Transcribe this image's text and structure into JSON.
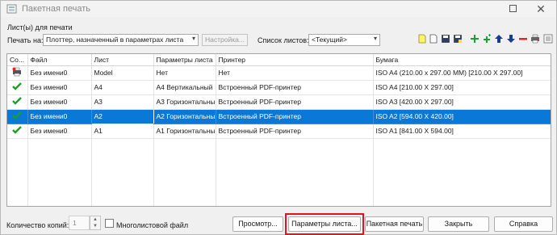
{
  "window": {
    "title": "Пакетная печать"
  },
  "section_label": "Лист(ы) для печати",
  "print_to": {
    "label": "Печать на:",
    "value": "Плоттер, назначенный в параметрах листа",
    "setup_label": "Настройка..."
  },
  "sheet_list": {
    "label": "Список листов:",
    "value": "<Текущий>"
  },
  "toolbar": {
    "icons": [
      "new-sheet-list-icon",
      "load-sheet-list-icon",
      "save-sheet-list-icon",
      "save-as-sheet-list-icon",
      "add-sheets-icon",
      "add-layouts-icon",
      "move-up-icon",
      "move-down-icon",
      "remove-sheets-icon",
      "plotter-manager-icon",
      "more-options-icon"
    ]
  },
  "table": {
    "headers": [
      "Со...",
      "Файл",
      "Лист",
      "Параметры листа",
      "Принтер",
      "Бумага"
    ],
    "rows": [
      {
        "status": "plot-icon",
        "file": "Без имени0",
        "sheet": "Model",
        "params": "Нет",
        "printer": "Нет",
        "paper": "ISO A4 (210.00 x 297.00 MM) [210.00 X 297.00]",
        "selected": false
      },
      {
        "status": "check-icon",
        "file": "Без имени0",
        "sheet": "A4",
        "params": "A4 Вертикальный",
        "printer": "Встроенный PDF-принтер",
        "paper": "ISO A4 [210.00 X 297.00]",
        "selected": false
      },
      {
        "status": "check-icon",
        "file": "Без имени0",
        "sheet": "A3",
        "params": "A3 Горизонтальны",
        "printer": "Встроенный PDF-принтер",
        "paper": "ISO A3 [420.00 X 297.00]",
        "selected": false
      },
      {
        "status": "check-icon",
        "file": "Без имени0",
        "sheet": "A2",
        "params": "A2 Горизонтальны",
        "printer": "Встроенный PDF-принтер",
        "paper": "ISO A2 [594.00 X 420.00]",
        "selected": true
      },
      {
        "status": "check-icon",
        "file": "Без имени0",
        "sheet": "A1",
        "params": "A1 Горизонтальны",
        "printer": "Встроенный PDF-принтер",
        "paper": "ISO A1 [841.00 X 594.00]",
        "selected": false
      }
    ]
  },
  "footer": {
    "copies_label": "Количество копий:",
    "copies_value": "1",
    "multisheet_label": "Многолистовой файл",
    "multisheet_checked": false,
    "preview_label": "Просмотр...",
    "params_label": "Параметры листа...",
    "batch_label": "Пакетная печать",
    "close_label": "Закрыть",
    "help_label": "Справка"
  },
  "colors": {
    "selection": "#0a78d7",
    "highlight_frame": "#e0141c",
    "check": "#1e9e2b"
  }
}
